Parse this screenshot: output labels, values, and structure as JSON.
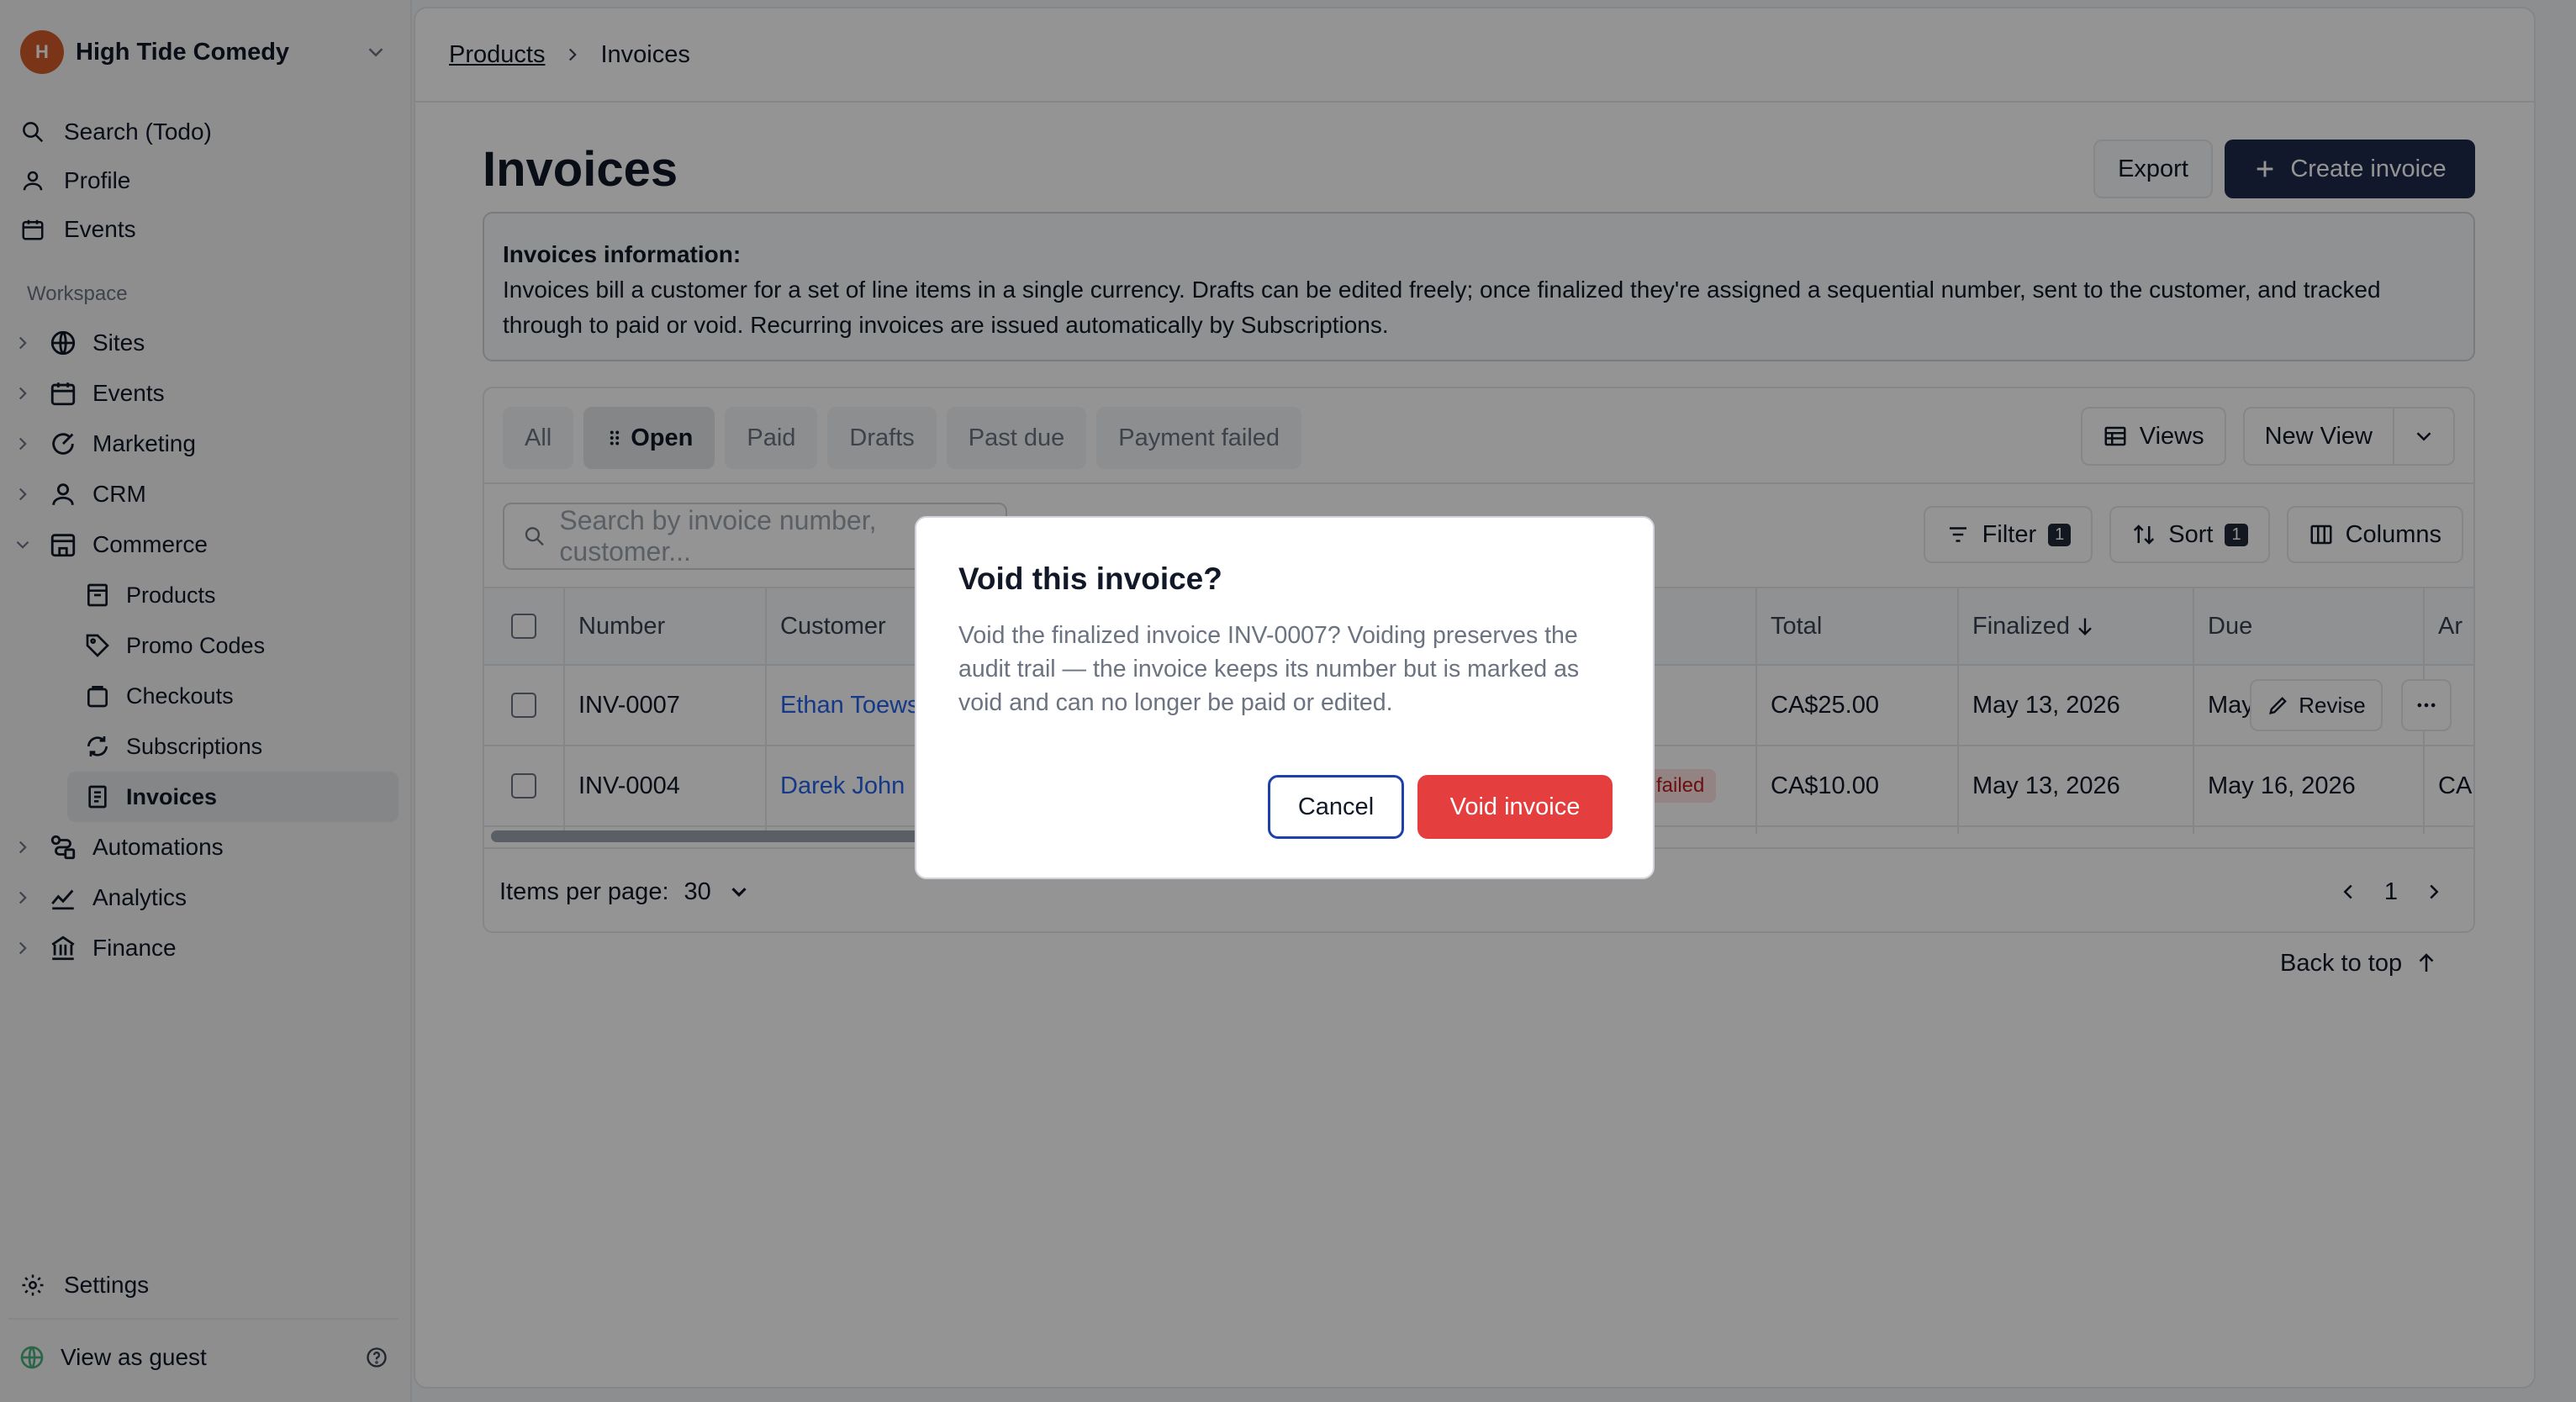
{
  "org": {
    "logo_text": "H",
    "name": "High Tide Comedy"
  },
  "nav_top": [
    {
      "label": "Search (Todo)",
      "icon": "search-icon"
    },
    {
      "label": "Profile",
      "icon": "user-icon"
    },
    {
      "label": "Events",
      "icon": "calendar-icon"
    }
  ],
  "workspace_label": "Workspace",
  "workspace": {
    "sites": "Sites",
    "events": "Events",
    "marketing": "Marketing",
    "crm": "CRM",
    "commerce": "Commerce",
    "commerce_children": {
      "products": "Products",
      "promo_codes": "Promo Codes",
      "checkouts": "Checkouts",
      "subscriptions": "Subscriptions",
      "invoices": "Invoices"
    },
    "automations": "Automations",
    "analytics": "Analytics",
    "finance": "Finance"
  },
  "settings_label": "Settings",
  "guest_label": "View as guest",
  "breadcrumb": {
    "parent": "Products",
    "current": "Invoices"
  },
  "page": {
    "title": "Invoices",
    "export_label": "Export",
    "create_label": "Create invoice"
  },
  "info": {
    "title": "Invoices information:",
    "text": "Invoices bill a customer for a set of line items in a single currency. Drafts can be edited freely; once finalized they're assigned a sequential number, sent to the customer, and tracked through to paid or void. Recurring invoices are issued automatically by Subscriptions."
  },
  "tabs": [
    "All",
    "Open",
    "Paid",
    "Drafts",
    "Past due",
    "Payment failed"
  ],
  "active_tab": "Open",
  "views": {
    "views_label": "Views",
    "new_view_label": "New View"
  },
  "search": {
    "placeholder": "Search by invoice number, customer..."
  },
  "tools": {
    "filter_label": "Filter",
    "filter_count": "1",
    "sort_label": "Sort",
    "sort_count": "1",
    "columns_label": "Columns"
  },
  "table": {
    "headers": {
      "number": "Number",
      "customer": "Customer",
      "total": "Total",
      "finalized": "Finalized",
      "due": "Due",
      "amount": "Ar"
    },
    "rows": [
      {
        "number": "INV-0007",
        "customer": "Ethan Toews",
        "status": "",
        "total": "CA$25.00",
        "finalized": "May 13, 2026",
        "due": "May",
        "amount": "CA"
      },
      {
        "number": "INV-0004",
        "customer": "Darek John",
        "status": "failed",
        "total": "CA$10.00",
        "finalized": "May 13, 2026",
        "due": "May 16, 2026",
        "amount": "CA"
      }
    ],
    "revise_label": "Revise"
  },
  "footer": {
    "items_per_page_label": "Items per page:",
    "items_per_page": "30",
    "page": "1"
  },
  "back_to_top": "Back to top",
  "dialog": {
    "title": "Void this invoice?",
    "body": "Void the finalized invoice INV-0007? Voiding preserves the audit trail — the invoice keeps its number but is marked as void and can no longer be paid or edited.",
    "cancel_label": "Cancel",
    "confirm_label": "Void invoice"
  },
  "colors": {
    "accent": "#1f2a4d",
    "danger": "#e53e3e",
    "link": "#2563eb",
    "logo": "#d25b2a"
  }
}
